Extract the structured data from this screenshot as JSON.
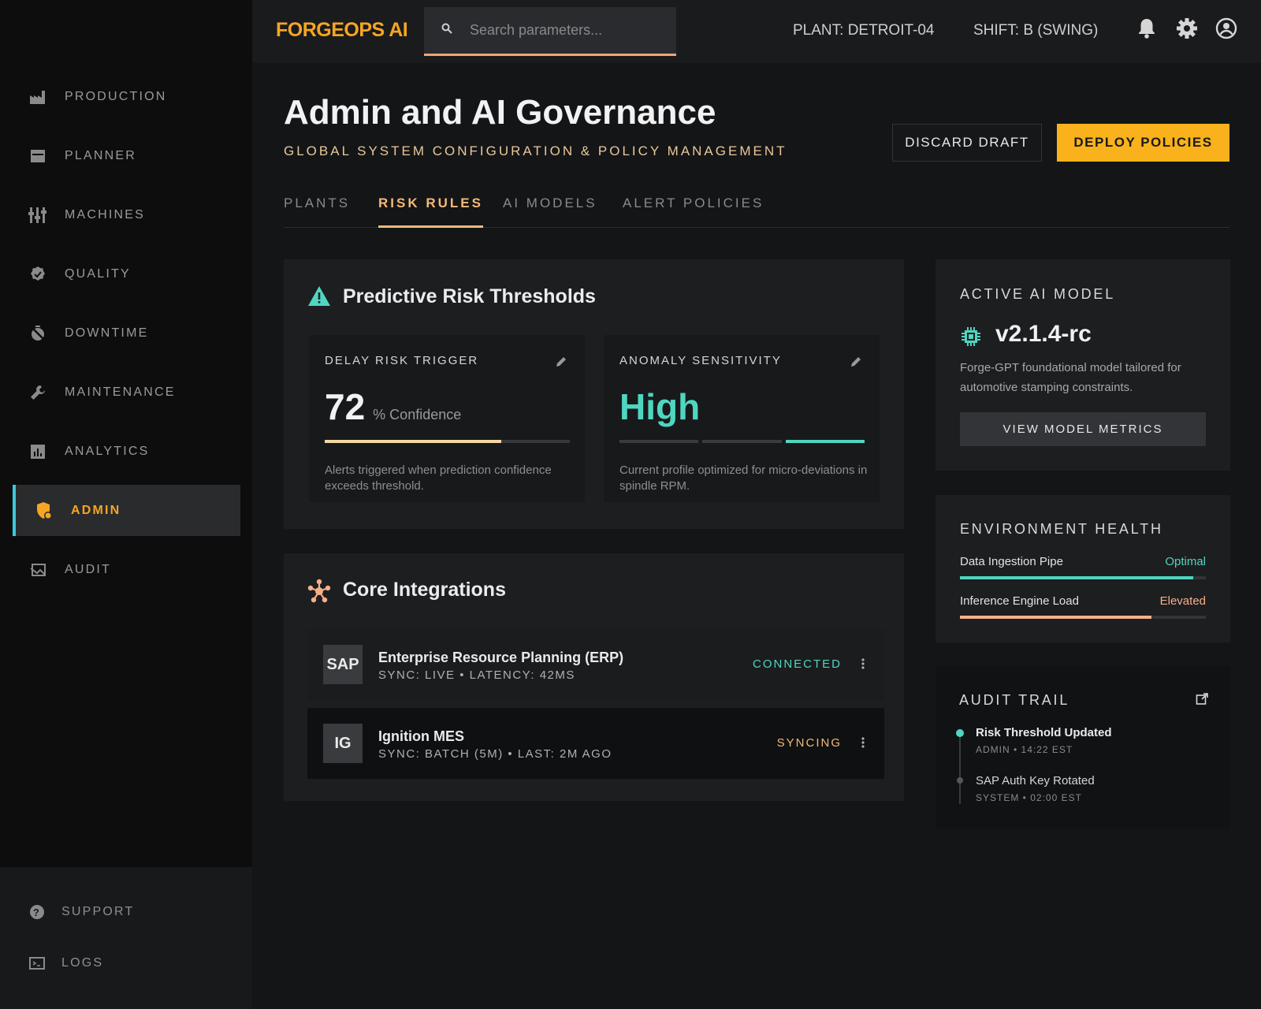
{
  "brand": "FORGEOPS AI",
  "search": {
    "placeholder": "Search parameters..."
  },
  "top": {
    "plant": "PLANT: DETROIT-04",
    "shift": "SHIFT: B (SWING)"
  },
  "sidebar": {
    "items": [
      {
        "label": "PRODUCTION",
        "icon": "factory-icon"
      },
      {
        "label": "PLANNER",
        "icon": "calendar-icon"
      },
      {
        "label": "MACHINES",
        "icon": "sliders-icon"
      },
      {
        "label": "QUALITY",
        "icon": "verified-badge-icon"
      },
      {
        "label": "DOWNTIME",
        "icon": "timer-off-icon"
      },
      {
        "label": "MAINTENANCE",
        "icon": "wrench-icon"
      },
      {
        "label": "ANALYTICS",
        "icon": "bar-chart-icon"
      },
      {
        "label": "ADMIN",
        "icon": "admin-shield-icon",
        "active": true
      },
      {
        "label": "AUDIT",
        "icon": "audit-icon"
      }
    ],
    "bottom": [
      {
        "label": "SUPPORT",
        "icon": "help-icon"
      },
      {
        "label": "LOGS",
        "icon": "terminal-icon"
      }
    ]
  },
  "header": {
    "title": "Admin and AI Governance",
    "subtitle": "GLOBAL SYSTEM CONFIGURATION & POLICY MANAGEMENT",
    "discard": "DISCARD DRAFT",
    "deploy": "DEPLOY POLICIES"
  },
  "tabs": [
    {
      "label": "PLANTS"
    },
    {
      "label": "RISK RULES",
      "active": true
    },
    {
      "label": "AI MODELS"
    },
    {
      "label": "ALERT POLICIES"
    }
  ],
  "risk": {
    "title": "Predictive Risk Thresholds",
    "delay": {
      "label": "DELAY RISK TRIGGER",
      "value": "72",
      "unit": "% Confidence",
      "level": 0.72,
      "desc": "Alerts triggered when prediction confidence exceeds threshold."
    },
    "anomaly": {
      "label": "ANOMALY SENSITIVITY",
      "value": "High",
      "level_step": 3,
      "level_steps": 3,
      "desc": "Current profile optimized for micro-deviations in spindle RPM."
    }
  },
  "integrations": {
    "title": "Core Integrations",
    "items": [
      {
        "logo": "SAP",
        "name": "Enterprise Resource Planning (ERP)",
        "meta": "SYNC: LIVE • LATENCY: 42MS",
        "status": "CONNECTED",
        "status_color": "#4fd6c0"
      },
      {
        "logo": "IG",
        "name": "Ignition MES",
        "meta": "SYNC: BATCH (5M) • LAST: 2M AGO",
        "status": "SYNCING",
        "status_color": "#f5b97a"
      }
    ]
  },
  "model": {
    "title": "ACTIVE AI MODEL",
    "version": "v2.1.4-rc",
    "desc": "Forge-GPT foundational model tailored for automotive stamping constraints.",
    "button": "VIEW MODEL METRICS"
  },
  "health": {
    "title": "ENVIRONMENT HEALTH",
    "rows": [
      {
        "label": "Data Ingestion Pipe",
        "value": "Optimal",
        "level": 0.95,
        "color": "#4fd6c0"
      },
      {
        "label": "Inference Engine Load",
        "value": "Elevated",
        "level": 0.78,
        "color": "#f5b08a"
      }
    ]
  },
  "audit": {
    "title": "AUDIT TRAIL",
    "items": [
      {
        "title": "Risk Threshold Updated",
        "meta": "ADMIN • 14:22 EST"
      },
      {
        "title": "SAP Auth Key Rotated",
        "meta": "SYSTEM • 02:00 EST"
      }
    ]
  },
  "colors": {
    "accent": "#f5a623",
    "teal": "#4fd6c0",
    "peach": "#f5b08a",
    "deploy": "#f9b21c"
  }
}
